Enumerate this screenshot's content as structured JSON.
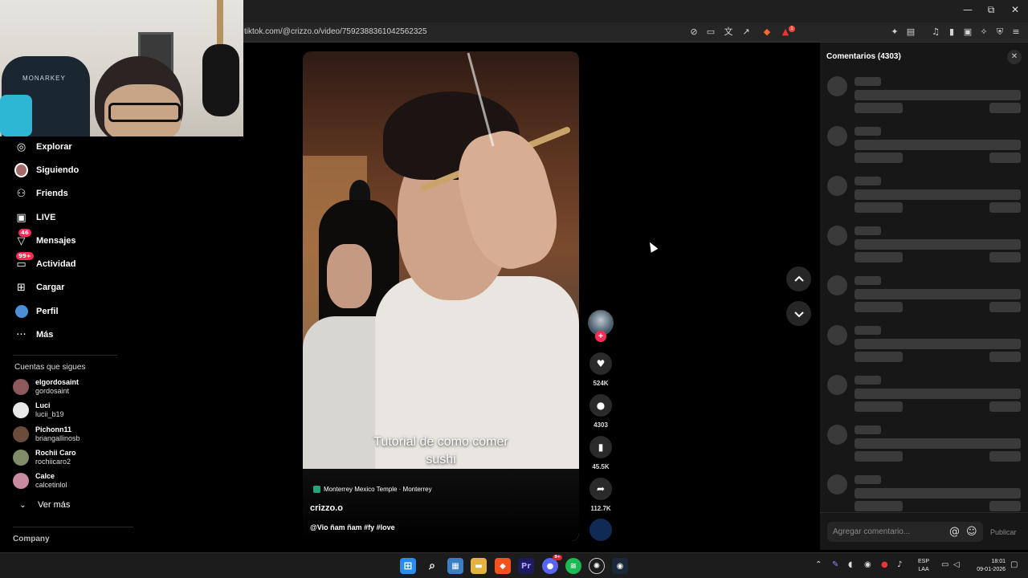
{
  "browser": {
    "url": "tiktok.com/@crizzo.o/video/7592388361042562325",
    "window_controls": {
      "minimize": "—",
      "restore": "⧉",
      "close": "✕"
    }
  },
  "webcam": {
    "brand": "MONARKEY"
  },
  "sidebar": {
    "nav": [
      {
        "label": "Explorar",
        "icon": "compass-icon",
        "glyph": "◎"
      },
      {
        "label": "Siguiendo",
        "icon": "following-avatar-icon",
        "glyph": "●"
      },
      {
        "label": "Friends",
        "icon": "friends-icon",
        "glyph": "👥"
      },
      {
        "label": "LIVE",
        "icon": "live-icon",
        "glyph": "▣"
      },
      {
        "label": "Mensajes",
        "icon": "messages-icon",
        "glyph": "▽",
        "badge": "46"
      },
      {
        "label": "Actividad",
        "icon": "activity-icon",
        "glyph": "▭",
        "badge": "99+"
      },
      {
        "label": "Cargar",
        "icon": "upload-icon",
        "glyph": "⊞"
      },
      {
        "label": "Perfil",
        "icon": "profile-icon",
        "glyph": "●"
      },
      {
        "label": "Más",
        "icon": "more-icon",
        "glyph": "···"
      }
    ],
    "following_title": "Cuentas que sigues",
    "accounts": [
      {
        "name": "elgordosaint",
        "username": "gordosaint",
        "color": "#8c5a5a"
      },
      {
        "name": "Luci",
        "username": "lucii_b19",
        "color": "#e8e8e8"
      },
      {
        "name": "Pichonn11",
        "username": "briangallinosb",
        "color": "#6b4c3b"
      },
      {
        "name": "Rochii Caro",
        "username": "rochiicaro2",
        "color": "#7f8c6a"
      },
      {
        "name": "Calce",
        "username": "calcetinlol",
        "color": "#c98aa0"
      }
    ],
    "see_more": "Ver más",
    "company": "Company"
  },
  "video": {
    "caption_line1": "Tutorial de como comer",
    "caption_line2": "sushi",
    "location": "Monterrey Mexico Temple · Monterrey",
    "author": "crizzo.o",
    "description": "@Vio ñam ñam #fy #love",
    "likes": "524K",
    "comments": "4303",
    "saves": "45.5K",
    "shares": "112.7K"
  },
  "comments_panel": {
    "title": "Comentarios (4303)",
    "placeholder": "Agregar comentario...",
    "post_label": "Publicar"
  },
  "taskbar": {
    "lang_line1": "ESP",
    "lang_line2": "LAA",
    "time": "18:01",
    "date": "09-01-2026",
    "discord_badge": "9+"
  }
}
